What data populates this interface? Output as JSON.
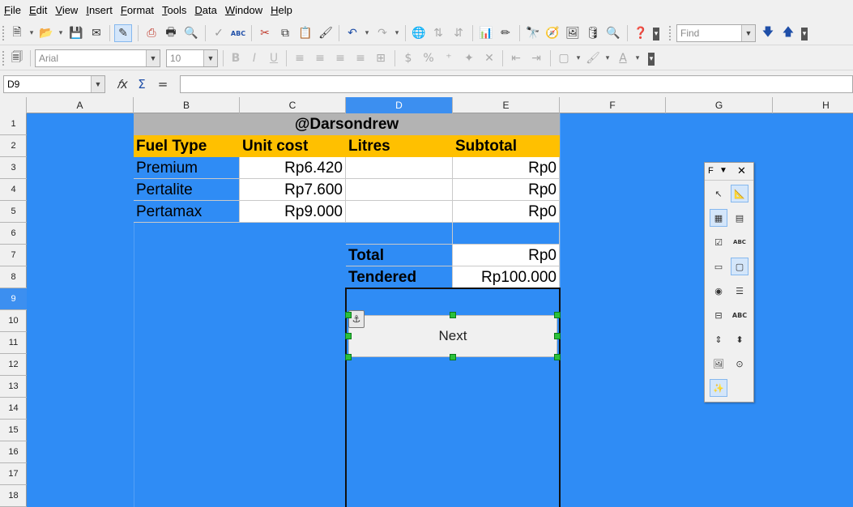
{
  "menubar": {
    "items": [
      "File",
      "Edit",
      "View",
      "Insert",
      "Format",
      "Tools",
      "Data",
      "Window",
      "Help"
    ]
  },
  "toolbar": {
    "find_placeholder": "Find",
    "font_name": "Arial",
    "font_size": "10"
  },
  "formula_bar": {
    "cell_ref": "D9",
    "formula": ""
  },
  "columns": [
    {
      "label": "A"
    },
    {
      "label": "B"
    },
    {
      "label": "C"
    },
    {
      "label": "D"
    },
    {
      "label": "E"
    },
    {
      "label": "F"
    },
    {
      "label": "G"
    },
    {
      "label": "H"
    }
  ],
  "selected_column": "D",
  "rows": [
    "1",
    "2",
    "3",
    "4",
    "5",
    "6",
    "7",
    "8",
    "9",
    "10",
    "11",
    "12",
    "13",
    "14",
    "15",
    "16",
    "17",
    "18"
  ],
  "selected_row": "9",
  "sheet": {
    "title": "@Darsondrew",
    "headers": [
      "Fuel Type",
      "Unit cost",
      "Litres",
      "Subtotal"
    ],
    "items": [
      {
        "fuel": "Premium",
        "cost": "Rp6.420",
        "litres": "",
        "subtotal": "Rp0"
      },
      {
        "fuel": "Pertalite",
        "cost": "Rp7.600",
        "litres": "",
        "subtotal": "Rp0"
      },
      {
        "fuel": "Pertamax",
        "cost": "Rp9.000",
        "litres": "",
        "subtotal": "Rp0"
      }
    ],
    "total_label": "Total",
    "total_value": "Rp0",
    "tendered_label": "Tendered",
    "tendered_value": "Rp100.000",
    "button_label": "Next"
  },
  "form_controls": {
    "title": "F",
    "buttons": [
      {
        "icon": "select-pointer-icon"
      },
      {
        "icon": "design-mode-icon"
      },
      {
        "icon": "control-properties-icon"
      },
      {
        "icon": "form-properties-icon"
      },
      {
        "icon": "checkbox-icon"
      },
      {
        "icon": "label-icon",
        "text": "ABC"
      },
      {
        "icon": "text-box-icon"
      },
      {
        "icon": "push-button-icon"
      },
      {
        "icon": "option-button-icon"
      },
      {
        "icon": "list-box-icon"
      },
      {
        "icon": "combo-box-icon"
      },
      {
        "icon": "label-field-icon",
        "text": "ABC"
      },
      {
        "icon": "scrollbar-icon"
      },
      {
        "icon": "spin-button-icon"
      },
      {
        "icon": "image-control-icon"
      },
      {
        "icon": "group-box-icon"
      },
      {
        "icon": "wizards-icon"
      }
    ]
  }
}
